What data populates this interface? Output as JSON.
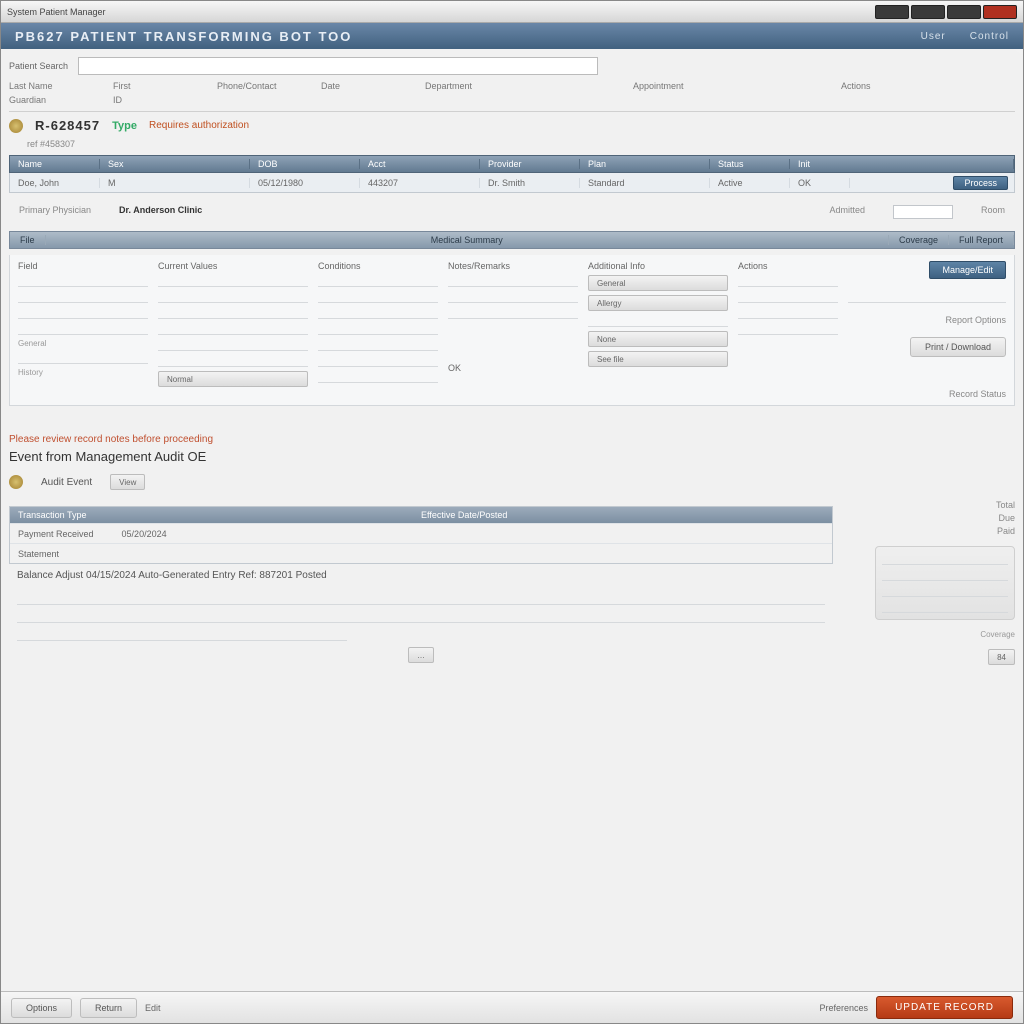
{
  "window": {
    "title": "System Patient Manager"
  },
  "header": {
    "title": "PB627  PATIENT  TRANSFORMING  BOT TOO",
    "link_user": "User",
    "link_control": "Control"
  },
  "search": {
    "label": "Patient Search",
    "value": ""
  },
  "filters": {
    "row1": [
      "Last Name",
      "First",
      "Phone/Contact",
      "Date",
      "Department",
      "",
      "Appointment",
      "",
      "Actions"
    ],
    "row2": [
      "Guardian",
      "",
      "ID",
      "",
      "",
      "",
      "",
      "",
      ""
    ]
  },
  "record": {
    "id": "R-628457",
    "type": "Type",
    "warn": "Requires authorization",
    "sub": "ref #458307"
  },
  "grid1": {
    "headers": [
      "Name",
      "Sex",
      "DOB",
      "Acct",
      "Provider",
      "Plan",
      "Status",
      "Init",
      ""
    ],
    "subheaders": [
      "Doe, John",
      "M",
      "05/12/1980",
      "443207",
      "Dr. Smith",
      "Standard",
      "Active",
      "OK"
    ],
    "action": "Process"
  },
  "info": {
    "label1": "Primary Physician",
    "value1": "Dr. Anderson Clinic",
    "label2": "Admitted",
    "label3": "Room"
  },
  "section": {
    "tabs": [
      "File",
      "Medical Summary",
      "Coverage",
      "Full Report"
    ]
  },
  "details": {
    "col1_head": "Field",
    "col2_head": "Current Values",
    "col3_head": "Conditions",
    "col4_head": "Notes/Remarks",
    "col5_head": "Additional Info",
    "actionsTitle": "Actions",
    "actionBtn": "Manage/Edit",
    "printLabel": "Report Options",
    "printBtn": "Print / Download",
    "ok": "OK",
    "stat1": "General",
    "v1": "Normal",
    "stat2": "Allergy",
    "v2": "None",
    "stat3": "History",
    "v3": "See file",
    "statusLabel": "Record Status"
  },
  "result": {
    "warn": "Please review record notes before proceeding",
    "title": "Event from Management Audit OE",
    "row_label": "Audit Event",
    "row_btn": "View"
  },
  "subgrid": {
    "hdr1": "Transaction Type",
    "hdr2": "Effective Date/Posted",
    "r1c1": "Payment Received",
    "r1c2": "05/20/2024",
    "r2c1": "Statement",
    "r3c1": "Balance Adjust",
    "r3c2": "04/15/2024",
    "r3c3": "Auto-Generated Entry",
    "r3c4": "Ref: 887201",
    "r3c5": "Posted"
  },
  "side": {
    "l1": "Total",
    "l2": "Due",
    "l3": "Paid",
    "cov": "Coverage",
    "btn": "84"
  },
  "footer": {
    "b1": "Options",
    "b2": "Return",
    "b3": "Edit",
    "link": "Preferences",
    "action": "UPDATE RECORD"
  }
}
